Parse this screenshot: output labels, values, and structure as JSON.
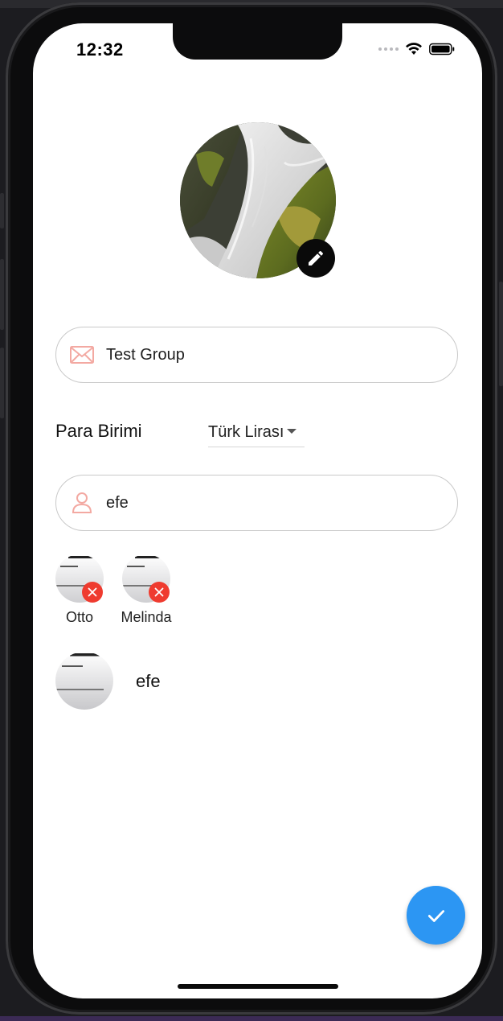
{
  "status_bar": {
    "time": "12:32"
  },
  "group": {
    "name_value": "Test Group",
    "name_icon": "mail-icon"
  },
  "currency": {
    "label": "Para Birimi",
    "selected": "Türk Lirası"
  },
  "member_search": {
    "value": "efe",
    "icon": "person-icon"
  },
  "selected_members": [
    {
      "name": "Otto"
    },
    {
      "name": "Melinda"
    }
  ],
  "search_results": [
    {
      "name": "efe"
    }
  ],
  "colors": {
    "fab": "#2c96f3",
    "remove_badge": "#ef3b2f",
    "field_icon": "#f3a9a2"
  }
}
